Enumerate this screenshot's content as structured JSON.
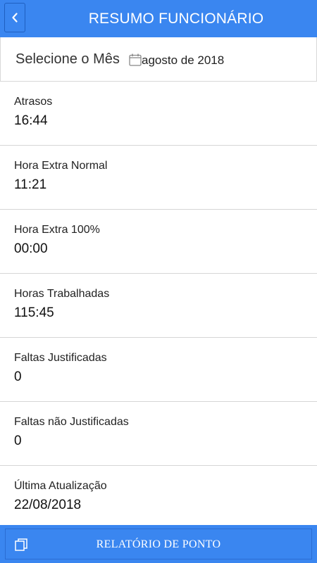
{
  "header": {
    "back_icon": "chevron-left-icon",
    "title": "RESUMO FUNCIONÁRIO"
  },
  "month_selector": {
    "label": "Selecione o Mês",
    "icon": "calendar-icon",
    "value": "agosto de 2018"
  },
  "summary": {
    "items": [
      {
        "label": "Atrasos",
        "value": "16:44"
      },
      {
        "label": "Hora Extra Normal",
        "value": "11:21"
      },
      {
        "label": "Hora Extra 100%",
        "value": "00:00"
      },
      {
        "label": "Horas Trabalhadas",
        "value": "115:45"
      },
      {
        "label": "Faltas Justificadas",
        "value": "0"
      },
      {
        "label": "Faltas não Justificadas",
        "value": "0"
      },
      {
        "label": "Última Atualização",
        "value": "22/08/2018"
      }
    ]
  },
  "footer": {
    "icon": "copy-icon",
    "button_label": "RELATÓRIO DE PONTO"
  },
  "colors": {
    "primary": "#3a86f0",
    "divider": "#d6d6d6"
  }
}
